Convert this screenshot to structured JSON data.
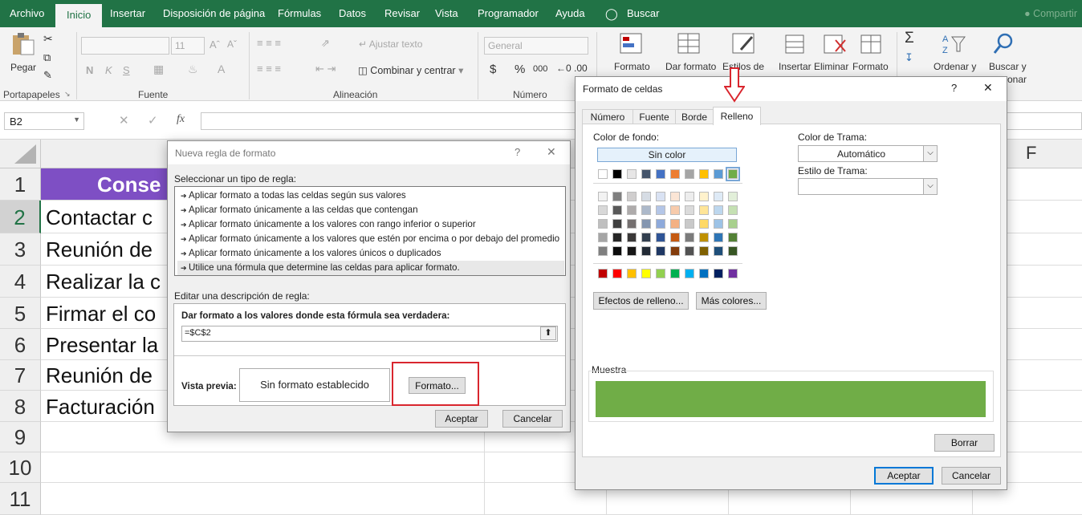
{
  "ribbon_tabs": [
    "Archivo",
    "Inicio",
    "Insertar",
    "Disposición de página",
    "Fórmulas",
    "Datos",
    "Revisar",
    "Vista",
    "Programador",
    "Ayuda",
    "Buscar"
  ],
  "share": "Compartir",
  "ribbon": {
    "clipboard": {
      "paste": "Pegar",
      "label": "Portapapeles"
    },
    "font": {
      "name": "",
      "size": "11",
      "bold": "N",
      "italic": "K",
      "underline": "S",
      "label": "Fuente"
    },
    "alignment": {
      "wrap": "Ajustar texto",
      "merge": "Combinar y centrar",
      "label": "Alineación"
    },
    "number": {
      "format": "General",
      "currency": "$",
      "percent": "%",
      "thousands": "000",
      "label": "Número"
    },
    "styles": {
      "cond": "Formato",
      "table": "Dar formato",
      "cell": "Estilos de"
    },
    "cells": {
      "insert": "Insertar",
      "delete": "Eliminar",
      "format": "Formato"
    },
    "editing": {
      "sort": "Ordenar y",
      "find": "Buscar y",
      "find2": "onar"
    }
  },
  "formula_bar": {
    "name_box": "B2",
    "fx": "fx",
    "formula": ""
  },
  "columns": {
    "F": "F"
  },
  "rows": [
    {
      "n": "1",
      "a": "Conse"
    },
    {
      "n": "2",
      "a": "Contactar c"
    },
    {
      "n": "3",
      "a": "Reunión de"
    },
    {
      "n": "4",
      "a": "Realizar la c"
    },
    {
      "n": "5",
      "a": "Firmar el co"
    },
    {
      "n": "6",
      "a": "Presentar la"
    },
    {
      "n": "7",
      "a": "Reunión de"
    },
    {
      "n": "8",
      "a": "Facturación"
    },
    {
      "n": "9",
      "a": ""
    },
    {
      "n": "10",
      "a": ""
    },
    {
      "n": "11",
      "a": ""
    }
  ],
  "header_fill": "#7e4fc4",
  "nueva_regla": {
    "title": "Nueva regla de formato",
    "help": "?",
    "close": "✕",
    "select_label": "Seleccionar un tipo de regla:",
    "rule_types": [
      "Aplicar formato a todas las celdas según sus valores",
      "Aplicar formato únicamente a las celdas que contengan",
      "Aplicar formato únicamente a los valores con rango inferior o superior",
      "Aplicar formato únicamente a los valores que estén por encima o por debajo del promedio",
      "Aplicar formato únicamente a los valores únicos o duplicados",
      "Utilice una fórmula que determine las celdas para aplicar formato."
    ],
    "edit_label": "Editar una descripción de regla:",
    "formula_label": "Dar formato a los valores donde esta fórmula sea verdadera:",
    "formula": "=$C$2",
    "preview_label": "Vista previa:",
    "preview_text": "Sin formato establecido",
    "format_button": "Formato...",
    "ok": "Aceptar",
    "cancel": "Cancelar"
  },
  "formato_celdas": {
    "title": "Formato de celdas",
    "help": "?",
    "close": "✕",
    "tabs": [
      "Número",
      "Fuente",
      "Borde",
      "Relleno"
    ],
    "active_tab": "Relleno",
    "bg_label": "Color de fondo:",
    "no_color": "Sin color",
    "pattern_color_label": "Color de Trama:",
    "pattern_color": "Automático",
    "pattern_style_label": "Estilo de Trama:",
    "fill_effects": "Efectos de relleno...",
    "more_colors": "Más colores...",
    "sample_label": "Muestra",
    "sample_color": "#70ad47",
    "clear": "Borrar",
    "ok": "Aceptar",
    "cancel": "Cancelar",
    "theme_row": [
      "#ffffff",
      "#000000",
      "#e7e6e6",
      "#44546a",
      "#4472c4",
      "#ed7d31",
      "#a5a5a5",
      "#ffc000",
      "#5b9bd5",
      "#70ad47"
    ],
    "shades": [
      [
        "#f2f2f2",
        "#7f7f7f",
        "#d0cece",
        "#d6dce4",
        "#d9e2f3",
        "#fbe5d5",
        "#ededed",
        "#fff2cc",
        "#deeaf6",
        "#e2efd9"
      ],
      [
        "#d8d8d8",
        "#595959",
        "#aeabab",
        "#adb9ca",
        "#b4c6e7",
        "#f7cbac",
        "#dbdbdb",
        "#ffe598",
        "#bdd7ee",
        "#c5e0b3"
      ],
      [
        "#bfbfbf",
        "#3f3f3f",
        "#757070",
        "#8496b0",
        "#8eaadb",
        "#f4b183",
        "#c9c9c9",
        "#ffd965",
        "#9dc3e6",
        "#a8d08d"
      ],
      [
        "#a5a5a5",
        "#262626",
        "#3a3838",
        "#323f4f",
        "#2f5496",
        "#c55a11",
        "#7b7b7b",
        "#bf9000",
        "#2e75b5",
        "#538135"
      ],
      [
        "#7f7f7f",
        "#0c0c0c",
        "#171616",
        "#222a35",
        "#1f3864",
        "#833c0b",
        "#525252",
        "#7f6000",
        "#1e4e79",
        "#375623"
      ]
    ],
    "standard_row": [
      "#c00000",
      "#ff0000",
      "#ffc000",
      "#ffff00",
      "#92d050",
      "#00b050",
      "#00b0f0",
      "#0070c0",
      "#002060",
      "#7030a0"
    ]
  },
  "highlight_color": "#d9262e"
}
